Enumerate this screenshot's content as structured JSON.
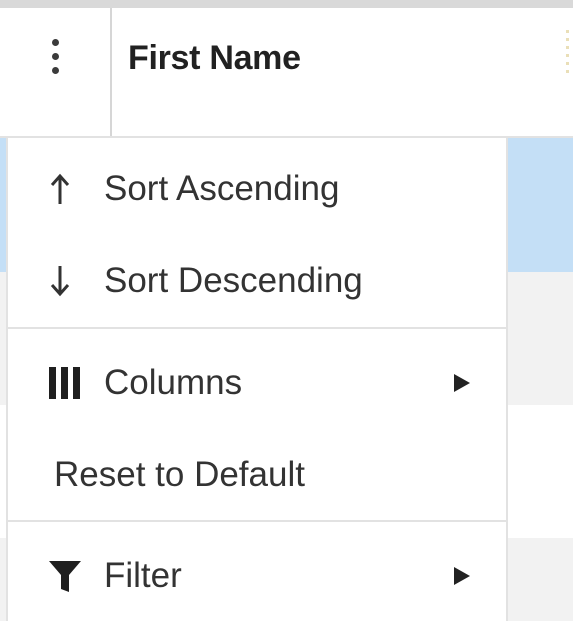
{
  "header": {
    "column_title": "First Name",
    "menu_button_icon": "kebab-menu-icon"
  },
  "menu": {
    "items": [
      {
        "label": "Sort Ascending",
        "icon": "arrow-up-icon",
        "glyph": "↑",
        "has_submenu": false
      },
      {
        "label": "Sort Descending",
        "icon": "arrow-down-icon",
        "glyph": "↓",
        "has_submenu": false
      },
      {
        "label": "Columns",
        "icon": "columns-icon",
        "has_submenu": true
      },
      {
        "label": "Reset to Default",
        "icon": null,
        "has_submenu": false
      },
      {
        "label": "Filter",
        "icon": "filter-icon",
        "has_submenu": true
      }
    ]
  },
  "colors": {
    "selected_row": "#c4dff6",
    "striped_row": "#f2f2f2",
    "border": "#e2e2e2",
    "text": "#333333",
    "header_text": "#212121"
  }
}
